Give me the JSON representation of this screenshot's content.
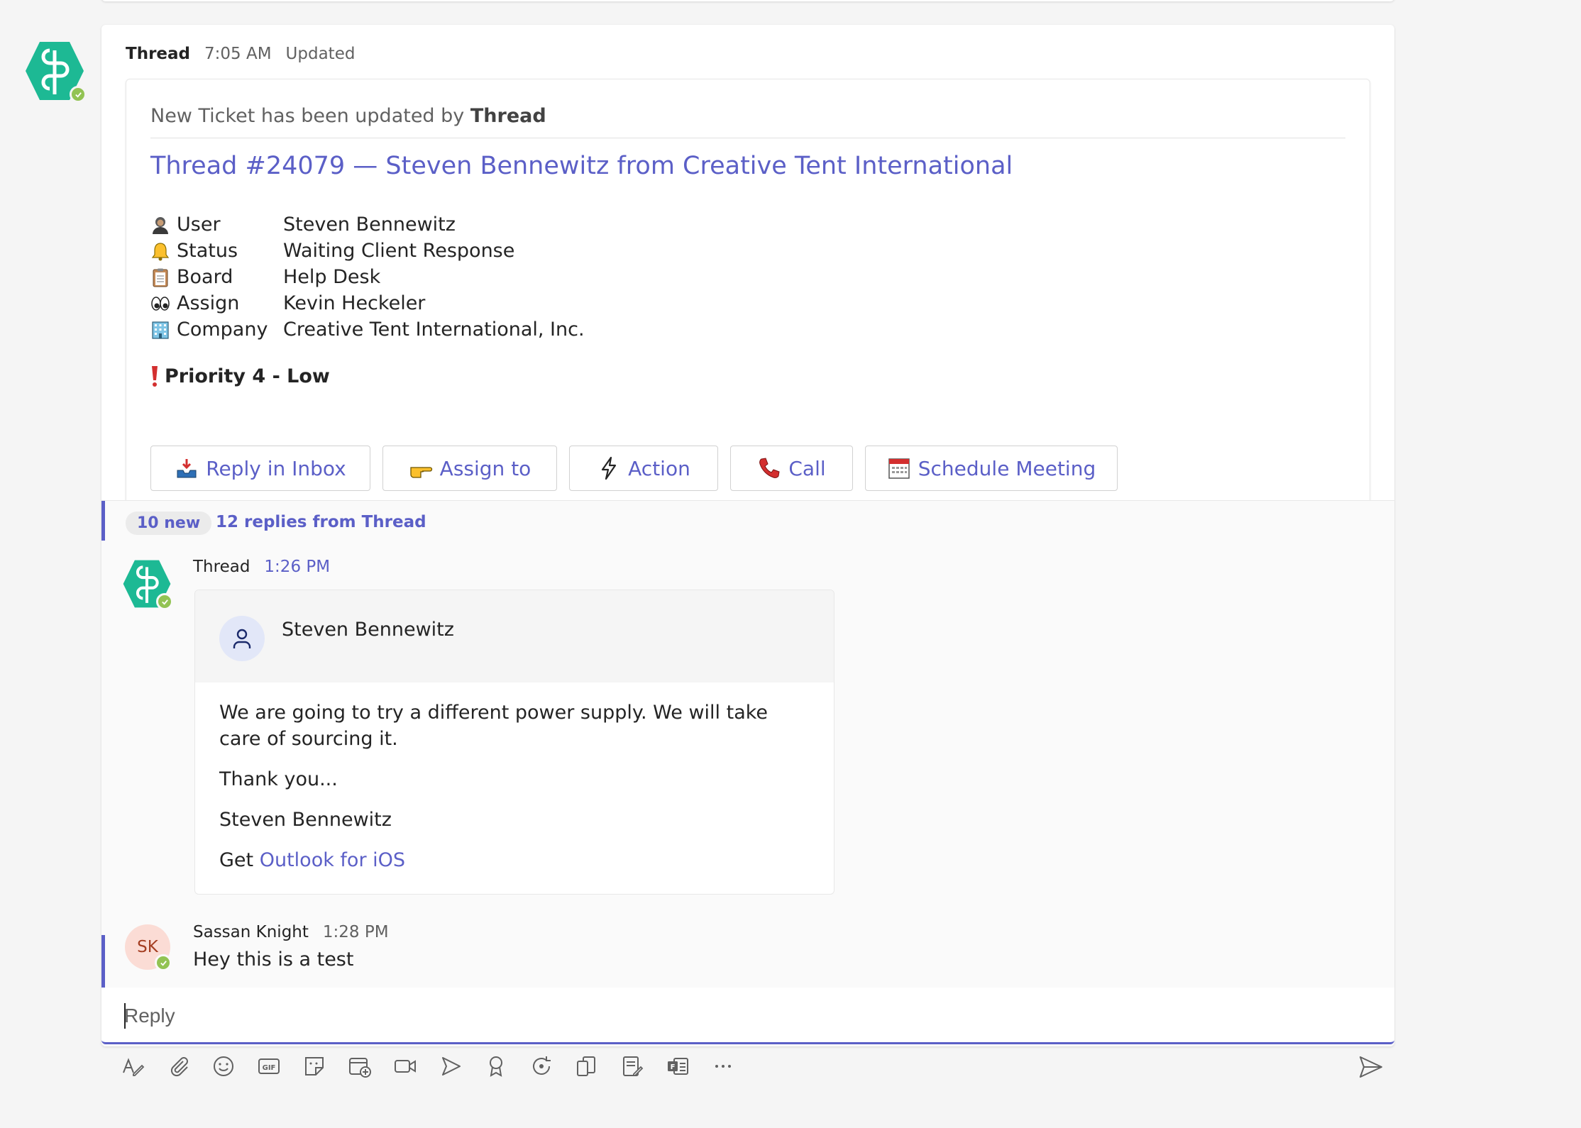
{
  "message": {
    "sender": "Thread",
    "time": "7:05 AM",
    "status": "Updated",
    "avatar_icon": "thread-logo-icon"
  },
  "card": {
    "updated_prefix": "New Ticket has been updated by",
    "updated_by": "Thread",
    "title": "Thread #24079 — Steven Bennewitz from Creative Tent International",
    "facts": [
      {
        "icon": "person-emoji-icon",
        "key": "User",
        "value": "Steven Bennewitz"
      },
      {
        "icon": "bell-emoji-icon",
        "key": "Status",
        "value": "Waiting Client Response"
      },
      {
        "icon": "clipboard-emoji-icon",
        "key": "Board",
        "value": "Help Desk"
      },
      {
        "icon": "eyes-emoji-icon",
        "key": "Assign",
        "value": "Kevin Heckeler"
      },
      {
        "icon": "office-building-emoji-icon",
        "key": "Company",
        "value": "Creative Tent International, Inc."
      }
    ],
    "priority": "Priority 4 - Low",
    "actions": [
      {
        "icon": "inbox-tray-icon",
        "label": "Reply in Inbox"
      },
      {
        "icon": "pointing-hand-icon",
        "label": "Assign to"
      },
      {
        "icon": "lightning-icon",
        "label": "Action"
      },
      {
        "icon": "telephone-icon",
        "label": "Call"
      },
      {
        "icon": "calendar-icon",
        "label": "Schedule Meeting"
      }
    ]
  },
  "replies": {
    "new_count": "10 new",
    "summary": "12 replies from Thread"
  },
  "reply1": {
    "sender": "Thread",
    "time": "1:26 PM",
    "email": {
      "from": "Steven Bennewitz",
      "body1": "We are going to try a different power supply. We will take care of sourcing it.",
      "body2": "Thank you...",
      "body3": "Steven Bennewitz",
      "get": "Get",
      "link": "Outlook for iOS"
    }
  },
  "reply2": {
    "initials": "SK",
    "sender": "Sassan Knight",
    "time": "1:28 PM",
    "text": "Hey this is a test"
  },
  "compose": {
    "placeholder": "Reply"
  },
  "colors": {
    "accent": "#5b5fc7",
    "presence": "#92c353",
    "logo": "#1db994"
  }
}
